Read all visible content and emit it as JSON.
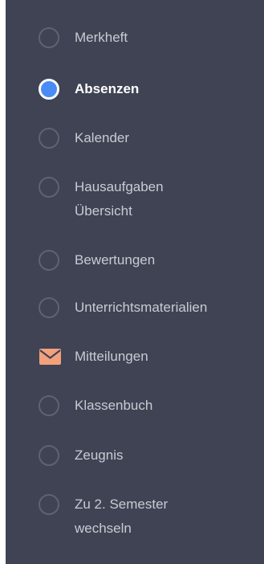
{
  "nav": {
    "items": [
      {
        "label": "Merkheft",
        "icon": "radio-empty-icon"
      },
      {
        "label": "Absenzen",
        "icon": "radio-selected-icon",
        "selected": true
      },
      {
        "label": "Kalender",
        "icon": "radio-empty-icon"
      },
      {
        "label": "Hausaufgaben",
        "label_line2": "Übersicht",
        "icon": "radio-empty-icon"
      },
      {
        "label": "Bewertungen",
        "icon": "radio-empty-icon"
      },
      {
        "label": "Unterrichtsmaterialien",
        "icon": "radio-empty-icon"
      },
      {
        "label": "Mitteilungen",
        "icon": "envelope-icon"
      },
      {
        "label": "Klassenbuch",
        "icon": "radio-empty-icon"
      },
      {
        "label": "Zeugnis",
        "icon": "radio-empty-icon"
      },
      {
        "label": "Zu 2. Semester",
        "label_line2": "wechseln",
        "icon": "radio-empty-icon"
      }
    ]
  },
  "colors": {
    "sidebar_background": "#3f4354",
    "selected_accent": "#4a8cf5",
    "envelope": "#f3a07c",
    "text": "#c9cbd3",
    "text_active": "#ffffff"
  }
}
